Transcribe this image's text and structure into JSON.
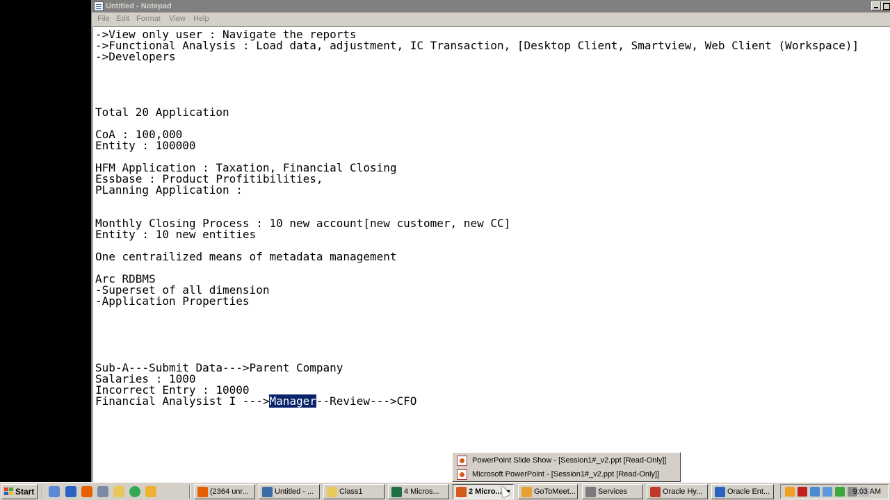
{
  "window": {
    "title": "Untitled - Notepad",
    "menu": [
      "File",
      "Edit",
      "Format",
      "View",
      "Help"
    ]
  },
  "editor": {
    "lines": [
      "->View only user : Navigate the reports",
      "->Functional Analysis : Load data, adjustment, IC Transaction, [Desktop Client, Smartview, Web Client (Workspace)]",
      "->Developers",
      "",
      "",
      "",
      "",
      "Total 20 Application",
      "",
      "CoA : 100,000",
      "Entity : 100000",
      "",
      "HFM Application : Taxation, Financial Closing",
      "Essbase : Product Profitibilities,",
      "PLanning Application :",
      "",
      "",
      "Monthly Closing Process : 10 new account[new customer, new CC]",
      "Entity : 10 new entities",
      "",
      "One centrailized means of metadata management",
      "",
      "Arc RDBMS",
      "-Superset of all dimension",
      "-Application Properties",
      "",
      "",
      "",
      "",
      "",
      "Sub-A---Submit Data--->Parent Company",
      "Salaries : 1000",
      "Incorrect Entry : 10000"
    ],
    "last_line": {
      "before": "Financial Analysist I --->",
      "selected": "Manager",
      "after": "--Review--->CFO"
    }
  },
  "popup": {
    "items": [
      "PowerPoint Slide Show - [Session1#_v2.ppt [Read-Only]]",
      "Microsoft PowerPoint - [Session1#_v2.ppt [Read-Only]]"
    ]
  },
  "taskbar": {
    "start_label": "Start",
    "tasks": [
      {
        "label": "(2364 unr...",
        "icon": "firefox-icon",
        "color": "#e66000"
      },
      {
        "label": "Untitled - ...",
        "icon": "notepad-icon",
        "color": "#3a6ea5"
      },
      {
        "label": "Class1",
        "icon": "folder-icon",
        "color": "#e8c85a"
      },
      {
        "label": "4 Micros...",
        "icon": "excel-icon",
        "color": "#1d7044"
      },
      {
        "label": "2 Micro...",
        "icon": "powerpoint-icon",
        "color": "#d45a1a"
      },
      {
        "label": "GoToMeet...",
        "icon": "gotomeeting-icon",
        "color": "#e8a030"
      },
      {
        "label": "Services",
        "icon": "gears-icon",
        "color": "#7a7a7a"
      },
      {
        "label": "Oracle Hy...",
        "icon": "oracle-icon",
        "color": "#c0392b"
      },
      {
        "label": "Oracle Ent...",
        "icon": "ie-icon",
        "color": "#2a64c0"
      }
    ],
    "clock": "9:03 AM"
  }
}
